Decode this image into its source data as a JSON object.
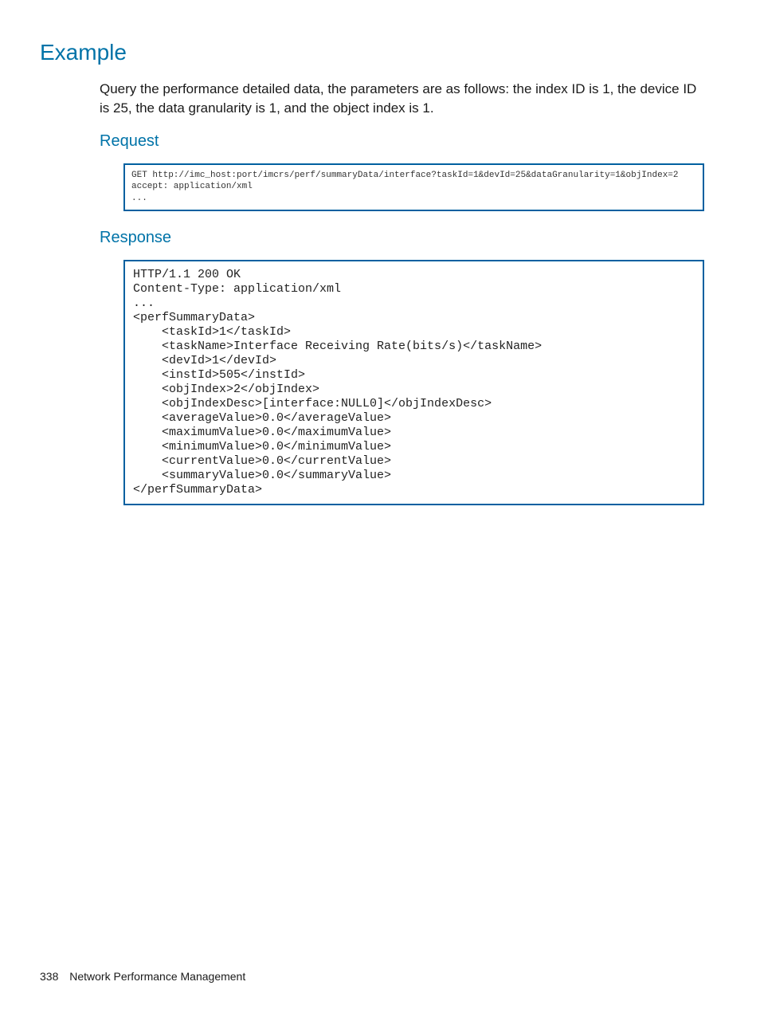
{
  "headings": {
    "example": "Example",
    "request": "Request",
    "response": "Response"
  },
  "paragraph": "Query the performance detailed data, the parameters are as follows: the index ID is 1, the device ID is 25, the data granularity is 1, and the object index is 1.",
  "request_code": "GET http://imc_host:port/imcrs/perf/summaryData/interface?taskId=1&devId=25&dataGranularity=1&objIndex=2\naccept: application/xml\n...",
  "response_code": "HTTP/1.1 200 OK\nContent-Type: application/xml\n...\n<perfSummaryData>\n    <taskId>1</taskId>\n    <taskName>Interface Receiving Rate(bits/s)</taskName>\n    <devId>1</devId>\n    <instId>505</instId>\n    <objIndex>2</objIndex>\n    <objIndexDesc>[interface:NULL0]</objIndexDesc>\n    <averageValue>0.0</averageValue>\n    <maximumValue>0.0</maximumValue>\n    <minimumValue>0.0</minimumValue>\n    <currentValue>0.0</currentValue>\n    <summaryValue>0.0</summaryValue>\n</perfSummaryData>",
  "footer": {
    "page_number": "338",
    "section_title": "Network Performance Management"
  }
}
